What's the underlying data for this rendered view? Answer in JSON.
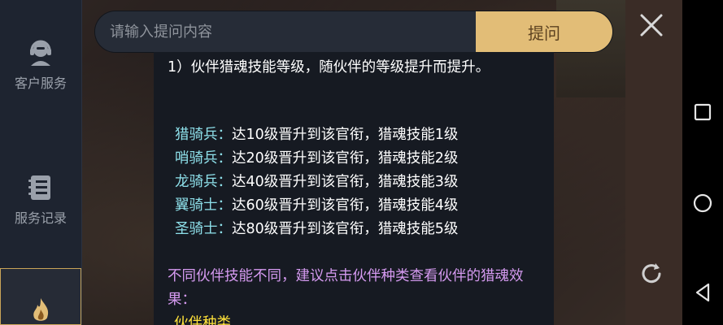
{
  "sidebar": {
    "items": [
      {
        "label": "客户服务",
        "icon": "customer-service-icon"
      },
      {
        "label": "服务记录",
        "icon": "service-records-icon"
      },
      {
        "label": "",
        "icon": "flame-icon"
      }
    ]
  },
  "search": {
    "placeholder": "请输入提问内容",
    "button_label": "提问"
  },
  "content": {
    "intro": "1）伙伴猎魂技能等级，随伙伴的等级提升而提升。",
    "tiers": [
      {
        "name": "猎骑兵",
        "sep": "：",
        "desc": "达10级晋升到该官衔，猎魂技能1级"
      },
      {
        "name": "哨骑兵",
        "sep": "：",
        "desc": "达20级晋升到该官衔，猎魂技能2级"
      },
      {
        "name": "龙骑兵",
        "sep": "：",
        "desc": "达40级晋升到该官衔，猎魂技能3级"
      },
      {
        "name": "翼骑士",
        "sep": "：",
        "desc": "达60级晋升到该官衔，猎魂技能4级"
      },
      {
        "name": "圣骑士",
        "sep": "：",
        "desc": "达80级晋升到该官衔，猎魂技能5级"
      }
    ],
    "note": "不同伙伴技能不同，建议点击伙伴种类查看伙伴的猎魂效果：",
    "partner_kind": "伙伴种类"
  },
  "colors": {
    "sidebar_bg": "#1e2430",
    "panel_bg": "#161a22",
    "accent_gold": "#e2bd77",
    "tier_name": "#8ee0ea",
    "note": "#d59af0",
    "highlight_yellow": "#ffe23a"
  },
  "nav": {
    "icons": [
      "close-icon",
      "recent-apps-icon",
      "home-icon",
      "refresh-icon",
      "back-icon"
    ]
  }
}
